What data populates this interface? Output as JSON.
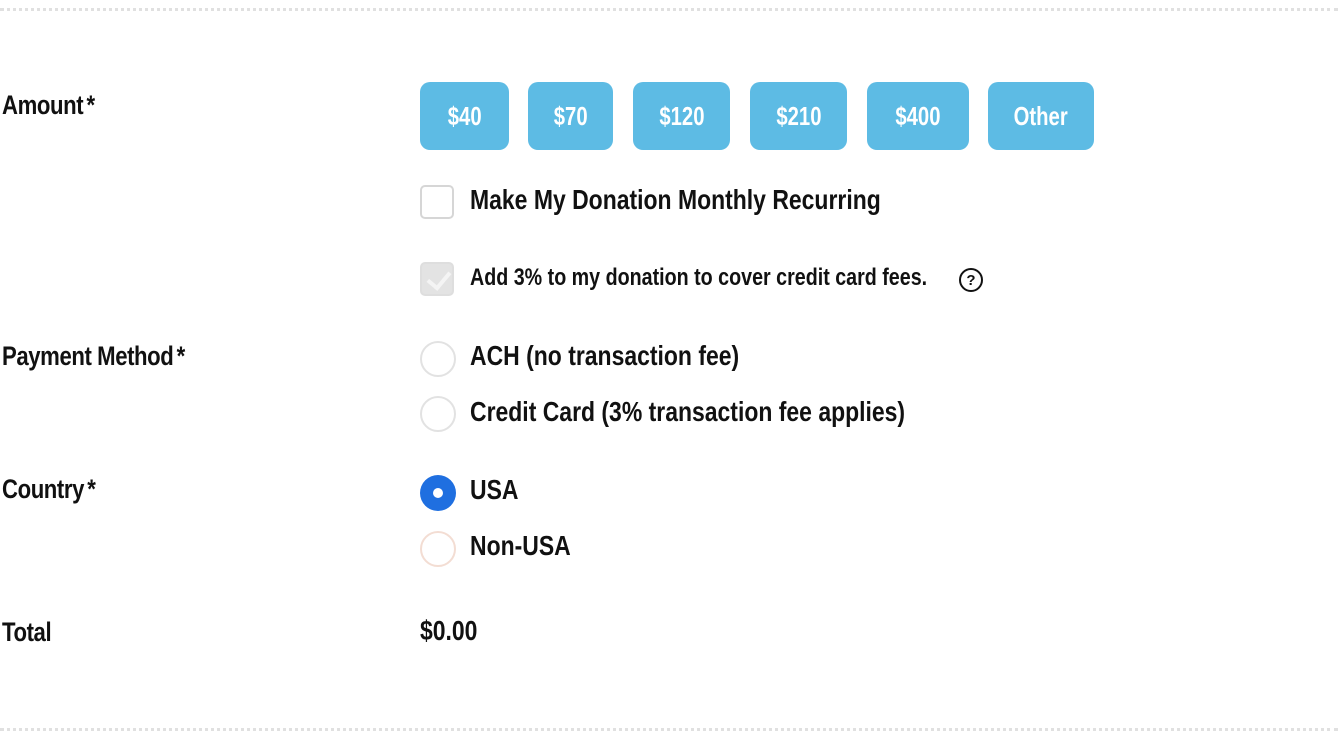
{
  "form": {
    "amount": {
      "label": "Amount",
      "required_mark": "*",
      "options": [
        "$40",
        "$70",
        "$120",
        "$210",
        "$400",
        "Other"
      ],
      "button_color": "#5dbbe4"
    },
    "recurring": {
      "label": "Make My Donation Monthly Recurring",
      "checked": false
    },
    "cover_fees": {
      "label": "Add 3% to my donation to cover credit card fees.",
      "checked": true,
      "help_icon": "?"
    },
    "payment_method": {
      "label": "Payment Method",
      "required_mark": "*",
      "options": [
        "ACH (no transaction fee)",
        "Credit Card (3% transaction fee applies)"
      ],
      "selected": null
    },
    "country": {
      "label": "Country",
      "required_mark": "*",
      "options": [
        "USA",
        "Non-USA"
      ],
      "selected": "USA",
      "accent": "#1f6fe0"
    },
    "total": {
      "label": "Total",
      "value": "$0.00"
    }
  }
}
